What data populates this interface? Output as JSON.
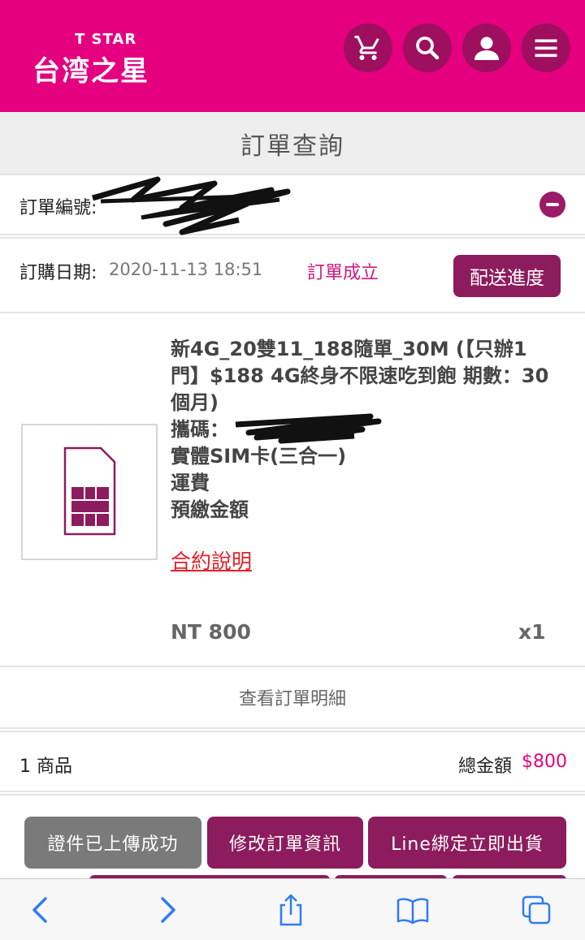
{
  "header": {
    "logo_sub": "T STAR",
    "logo_main": "台湾之星",
    "brand_color": "#e5007f",
    "icons": [
      "cart-icon",
      "search-icon",
      "user-icon",
      "menu-icon"
    ]
  },
  "page_title": "訂單查詢",
  "order": {
    "number_label": "訂單編號:",
    "date_label": "訂購日期:",
    "date_value": "2020-11-13 18:51",
    "status": "訂單成立",
    "ship_button": "配送進度"
  },
  "product": {
    "name": "新4G_20雙11_188隨單_30M (【只辦1門】$188 4G終身不限速吃到飽 期數：30個月)",
    "port_label": "攜碼：",
    "sim_type": "實體SIM卡(三合一)",
    "shipping": "運費",
    "prepaid": "預繳金額",
    "contract_link": "合約說明",
    "price": "NT 800",
    "quantity": "x1"
  },
  "detail_link": "查看訂單明細",
  "summary": {
    "items_count": "1 商品",
    "total_label": "總金額",
    "total_amount": "$800"
  },
  "actions": {
    "upload_done": "證件已上傳成功",
    "edit_order": "修改訂單資訊",
    "line_ship": "Line綁定立即出貨"
  },
  "browser_toolbar": [
    "back-icon",
    "forward-icon",
    "share-icon",
    "bookmarks-icon",
    "tabs-icon"
  ]
}
